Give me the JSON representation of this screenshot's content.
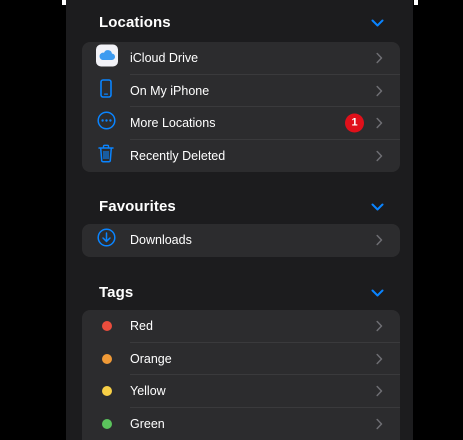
{
  "locations": {
    "title": "Locations",
    "items": [
      {
        "label": "iCloud Drive",
        "icon": "icloud-icon"
      },
      {
        "label": "On My iPhone",
        "icon": "iphone-icon"
      },
      {
        "label": "More Locations",
        "icon": "ellipsis-circle-icon",
        "badge": "1"
      },
      {
        "label": "Recently Deleted",
        "icon": "trash-icon"
      }
    ]
  },
  "favourites": {
    "title": "Favourites",
    "items": [
      {
        "label": "Downloads",
        "icon": "download-circle-icon"
      }
    ]
  },
  "tags": {
    "title": "Tags",
    "items": [
      {
        "label": "Red",
        "color": "#eb4d3d"
      },
      {
        "label": "Orange",
        "color": "#f09a37"
      },
      {
        "label": "Yellow",
        "color": "#f7cf46"
      },
      {
        "label": "Green",
        "color": "#5bc35c"
      }
    ]
  },
  "colors": {
    "accent": "#0a84ff",
    "badge": "#e0101a",
    "background": "#1c1c1e",
    "row_background": "#2c2c2e"
  }
}
